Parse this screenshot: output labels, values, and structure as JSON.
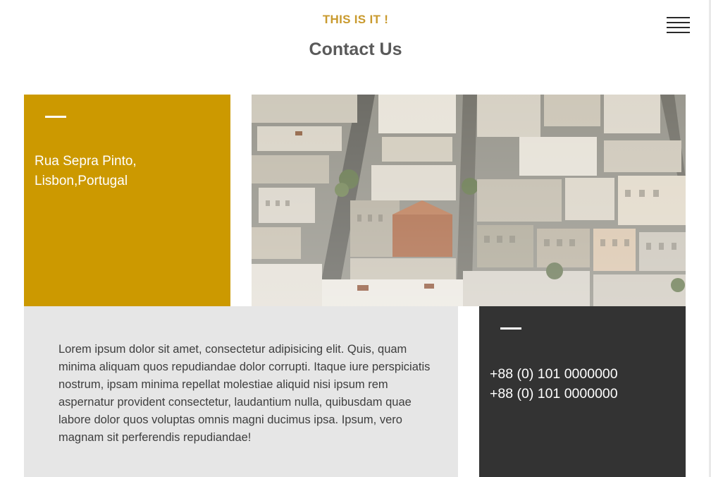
{
  "header": {
    "tagline": "THIS IS IT !",
    "title": "Contact Us",
    "menu_icon": "hamburger-menu-icon"
  },
  "address": {
    "line1": "Rua Sepra Pinto,",
    "line2": "Lisbon,Portugal"
  },
  "photo": {
    "subject": "aerial view of city rooftops"
  },
  "body": {
    "text": "Lorem ipsum dolor sit amet, consectetur adipisicing elit. Quis, quam minima aliquam quos repudiandae dolor corrupti. Itaque iure perspiciatis nostrum, ipsam minima repellat molestiae aliquid nisi ipsum rem aspernatur provident consectetur, laudantium nulla, quibusdam quae labore dolor quos voluptas omnis magni ducimus ipsa. Ipsum, vero magnam sit perferendis repudiandae!"
  },
  "phones": {
    "phone1": "+88 (0) 101 0000000",
    "phone2": "+88 (0) 101 0000000"
  },
  "colors": {
    "accent_gold": "#cc9900",
    "tagline_gold": "#c99a2e",
    "dark_panel": "#333333",
    "light_panel": "#e6e6e6",
    "title_gray": "#5a5a5a"
  }
}
